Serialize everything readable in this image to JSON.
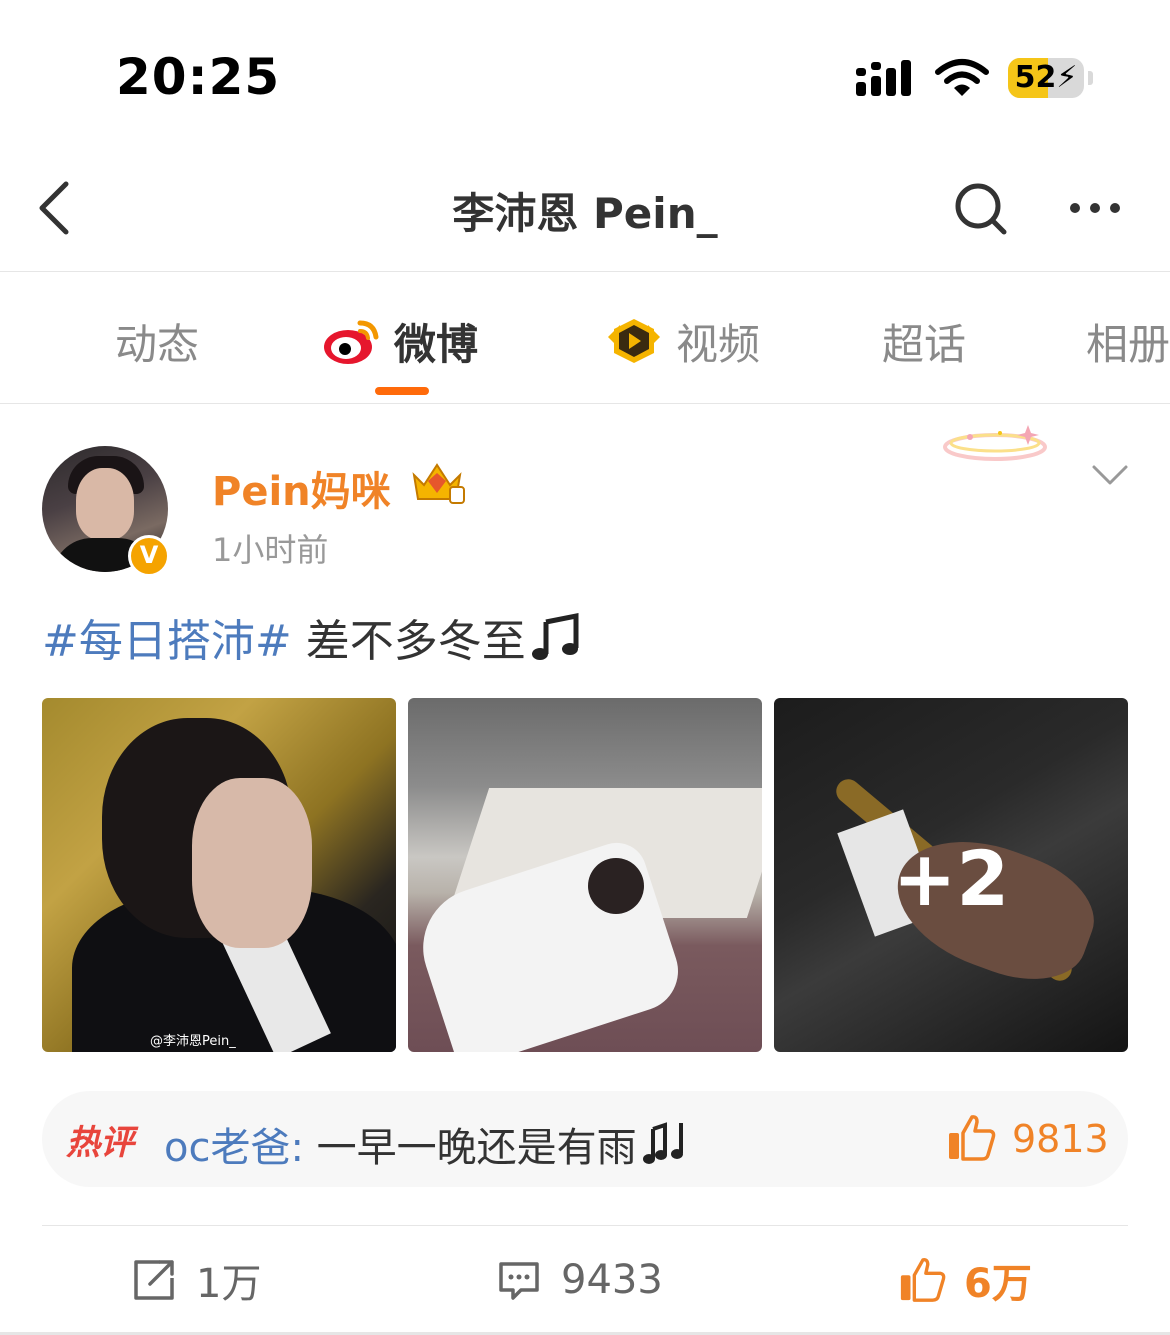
{
  "status_bar": {
    "time": "20:25",
    "battery_level": "52",
    "battery_charging": true
  },
  "nav": {
    "title": "李沛恩 Pein_",
    "icons": [
      "back-icon",
      "search-icon",
      "more-icon"
    ]
  },
  "tabs": [
    {
      "label": "动态",
      "icon": null,
      "active": false
    },
    {
      "label": "微博",
      "icon": "weibo-logo-icon",
      "active": true
    },
    {
      "label": "视频",
      "icon": "video-badge-icon",
      "active": false
    },
    {
      "label": "超话",
      "icon": null,
      "active": false
    },
    {
      "label": "相册",
      "icon": null,
      "active": false
    }
  ],
  "post": {
    "username": "Pein妈咪",
    "time": "1小时前",
    "topic": "#每日搭沛#",
    "text": "差不多冬至",
    "image_watermark": "@李沛恩Pein_",
    "more_images": "+2",
    "hot_comment": {
      "label": "热评",
      "commenter": "oc老爸",
      "separator": ":",
      "text": "一早一晚还是有雨",
      "likes": "9813"
    },
    "actions": {
      "reposts": "1万",
      "comments": "9433",
      "likes": "6万"
    }
  },
  "colors": {
    "accent_orange": "#f08327",
    "tab_indicator": "#ff6a0a",
    "topic_blue": "#4d7bbd",
    "hot_red": "#e8453c"
  }
}
